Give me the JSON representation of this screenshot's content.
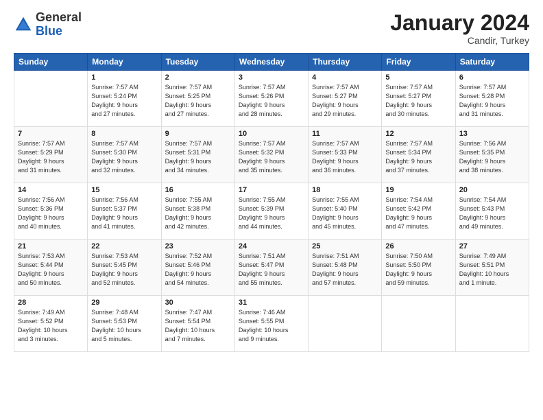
{
  "header": {
    "logo_general": "General",
    "logo_blue": "Blue",
    "month_title": "January 2024",
    "subtitle": "Candir, Turkey"
  },
  "weekdays": [
    "Sunday",
    "Monday",
    "Tuesday",
    "Wednesday",
    "Thursday",
    "Friday",
    "Saturday"
  ],
  "weeks": [
    [
      {
        "day": null,
        "info": null
      },
      {
        "day": "1",
        "info": "Sunrise: 7:57 AM\nSunset: 5:24 PM\nDaylight: 9 hours\nand 27 minutes."
      },
      {
        "day": "2",
        "info": "Sunrise: 7:57 AM\nSunset: 5:25 PM\nDaylight: 9 hours\nand 27 minutes."
      },
      {
        "day": "3",
        "info": "Sunrise: 7:57 AM\nSunset: 5:26 PM\nDaylight: 9 hours\nand 28 minutes."
      },
      {
        "day": "4",
        "info": "Sunrise: 7:57 AM\nSunset: 5:27 PM\nDaylight: 9 hours\nand 29 minutes."
      },
      {
        "day": "5",
        "info": "Sunrise: 7:57 AM\nSunset: 5:27 PM\nDaylight: 9 hours\nand 30 minutes."
      },
      {
        "day": "6",
        "info": "Sunrise: 7:57 AM\nSunset: 5:28 PM\nDaylight: 9 hours\nand 31 minutes."
      }
    ],
    [
      {
        "day": "7",
        "info": "Sunrise: 7:57 AM\nSunset: 5:29 PM\nDaylight: 9 hours\nand 31 minutes."
      },
      {
        "day": "8",
        "info": "Sunrise: 7:57 AM\nSunset: 5:30 PM\nDaylight: 9 hours\nand 32 minutes."
      },
      {
        "day": "9",
        "info": "Sunrise: 7:57 AM\nSunset: 5:31 PM\nDaylight: 9 hours\nand 34 minutes."
      },
      {
        "day": "10",
        "info": "Sunrise: 7:57 AM\nSunset: 5:32 PM\nDaylight: 9 hours\nand 35 minutes."
      },
      {
        "day": "11",
        "info": "Sunrise: 7:57 AM\nSunset: 5:33 PM\nDaylight: 9 hours\nand 36 minutes."
      },
      {
        "day": "12",
        "info": "Sunrise: 7:57 AM\nSunset: 5:34 PM\nDaylight: 9 hours\nand 37 minutes."
      },
      {
        "day": "13",
        "info": "Sunrise: 7:56 AM\nSunset: 5:35 PM\nDaylight: 9 hours\nand 38 minutes."
      }
    ],
    [
      {
        "day": "14",
        "info": "Sunrise: 7:56 AM\nSunset: 5:36 PM\nDaylight: 9 hours\nand 40 minutes."
      },
      {
        "day": "15",
        "info": "Sunrise: 7:56 AM\nSunset: 5:37 PM\nDaylight: 9 hours\nand 41 minutes."
      },
      {
        "day": "16",
        "info": "Sunrise: 7:55 AM\nSunset: 5:38 PM\nDaylight: 9 hours\nand 42 minutes."
      },
      {
        "day": "17",
        "info": "Sunrise: 7:55 AM\nSunset: 5:39 PM\nDaylight: 9 hours\nand 44 minutes."
      },
      {
        "day": "18",
        "info": "Sunrise: 7:55 AM\nSunset: 5:40 PM\nDaylight: 9 hours\nand 45 minutes."
      },
      {
        "day": "19",
        "info": "Sunrise: 7:54 AM\nSunset: 5:42 PM\nDaylight: 9 hours\nand 47 minutes."
      },
      {
        "day": "20",
        "info": "Sunrise: 7:54 AM\nSunset: 5:43 PM\nDaylight: 9 hours\nand 49 minutes."
      }
    ],
    [
      {
        "day": "21",
        "info": "Sunrise: 7:53 AM\nSunset: 5:44 PM\nDaylight: 9 hours\nand 50 minutes."
      },
      {
        "day": "22",
        "info": "Sunrise: 7:53 AM\nSunset: 5:45 PM\nDaylight: 9 hours\nand 52 minutes."
      },
      {
        "day": "23",
        "info": "Sunrise: 7:52 AM\nSunset: 5:46 PM\nDaylight: 9 hours\nand 54 minutes."
      },
      {
        "day": "24",
        "info": "Sunrise: 7:51 AM\nSunset: 5:47 PM\nDaylight: 9 hours\nand 55 minutes."
      },
      {
        "day": "25",
        "info": "Sunrise: 7:51 AM\nSunset: 5:48 PM\nDaylight: 9 hours\nand 57 minutes."
      },
      {
        "day": "26",
        "info": "Sunrise: 7:50 AM\nSunset: 5:50 PM\nDaylight: 9 hours\nand 59 minutes."
      },
      {
        "day": "27",
        "info": "Sunrise: 7:49 AM\nSunset: 5:51 PM\nDaylight: 10 hours\nand 1 minute."
      }
    ],
    [
      {
        "day": "28",
        "info": "Sunrise: 7:49 AM\nSunset: 5:52 PM\nDaylight: 10 hours\nand 3 minutes."
      },
      {
        "day": "29",
        "info": "Sunrise: 7:48 AM\nSunset: 5:53 PM\nDaylight: 10 hours\nand 5 minutes."
      },
      {
        "day": "30",
        "info": "Sunrise: 7:47 AM\nSunset: 5:54 PM\nDaylight: 10 hours\nand 7 minutes."
      },
      {
        "day": "31",
        "info": "Sunrise: 7:46 AM\nSunset: 5:55 PM\nDaylight: 10 hours\nand 9 minutes."
      },
      {
        "day": null,
        "info": null
      },
      {
        "day": null,
        "info": null
      },
      {
        "day": null,
        "info": null
      }
    ]
  ]
}
